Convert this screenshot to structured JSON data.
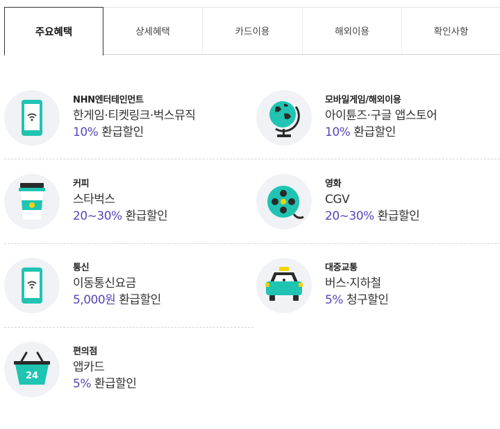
{
  "tabs": [
    {
      "label": "주요혜택",
      "active": true
    },
    {
      "label": "상세혜택",
      "active": false
    },
    {
      "label": "카드이용",
      "active": false
    },
    {
      "label": "해외이용",
      "active": false
    },
    {
      "label": "확인사항",
      "active": false
    }
  ],
  "benefits": [
    {
      "category": "NHN엔터테인먼트",
      "description": "한게임·티켓링크·벅스뮤직",
      "rate": "10%",
      "rate_suffix": " 환급할인",
      "icon": "smartphone-wifi-icon"
    },
    {
      "category": "모바일게임/해외이용",
      "description": "아이튠즈·구글 앱스토어",
      "rate": "10%",
      "rate_suffix": " 환급할인",
      "icon": "globe-icon"
    },
    {
      "category": "커피",
      "description": "스타벅스",
      "rate": "20~30%",
      "rate_suffix": " 환급할인",
      "icon": "coffee-cup-icon"
    },
    {
      "category": "영화",
      "description": "CGV",
      "rate": "20~30%",
      "rate_suffix": " 환급할인",
      "icon": "film-reel-icon"
    },
    {
      "category": "통신",
      "description": "이동통신요금",
      "rate": "5,000원",
      "rate_suffix": " 환급할인",
      "icon": "smartphone-wifi-icon"
    },
    {
      "category": "대중교통",
      "description": "버스·지하철",
      "rate": "5%",
      "rate_suffix": " 청구할인",
      "icon": "taxi-icon"
    },
    {
      "category": "편의점",
      "description": "앱카드",
      "rate": "5%",
      "rate_suffix": " 환급할인",
      "icon": "shopping-basket-icon",
      "badge": "24"
    }
  ],
  "colors": {
    "accent": "#5447b8",
    "icon_teal": "#20c4b2",
    "icon_bg": "#f0f2f5"
  }
}
